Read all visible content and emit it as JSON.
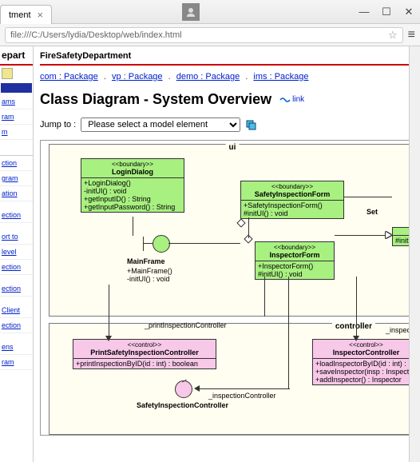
{
  "browser": {
    "tab_title": "tment",
    "address": "file:///C:/Users/lydia/Desktop/web/index.html"
  },
  "sidebar": {
    "header": "epart",
    "items": [
      "ams",
      "ram",
      "m",
      "ction",
      "gram",
      "ation",
      "ection",
      "ort to",
      "level",
      "ection",
      "ection",
      "Client",
      "ection",
      "ens",
      "ram"
    ]
  },
  "main": {
    "department": "FireSafetyDepartment",
    "breadcrumbs": [
      {
        "label": "com : Package"
      },
      {
        "label": "vp : Package"
      },
      {
        "label": "demo : Package"
      },
      {
        "label": "ims : Package"
      }
    ],
    "title": "Class Diagram - System Overview",
    "link_label": "link",
    "jump_label": "Jump to :",
    "jump_placeholder": "Please select a model element"
  },
  "diagram": {
    "pkg_ui": "ui",
    "pkg_controller": "controller",
    "set_label": "Set",
    "login_dialog": {
      "stereotype": "<<boundary>>",
      "name": "LoginDialog",
      "ops": [
        "+LoginDialog()",
        "-initUI() : void",
        "+getInputID() : String",
        "+getInputPassword() : String"
      ]
    },
    "safety_inspection_form": {
      "stereotype": "<<boundary>>",
      "name": "SafetyInspectionForm",
      "ops": [
        "+SafetyInspectionForm()",
        "#initUI() : void"
      ]
    },
    "inspector_form": {
      "stereotype": "<<boundary>>",
      "name": "InspectorForm",
      "ops": [
        "+InspectorForm()",
        "#initUI() : void"
      ]
    },
    "init_ui_box": {
      "ops": [
        "#initUI() :"
      ]
    },
    "main_frame": {
      "name": "MainFrame",
      "ops": [
        "+MainFrame()",
        "-initUI() : void"
      ]
    },
    "print_ctrl_label": "_printInspectionController",
    "inspection_ctrl_label": "_inspectionController",
    "inspec_label": "_inspec",
    "print_controller": {
      "stereotype": "<<control>>",
      "name": "PrintSafetyInspectionController",
      "ops": [
        "+printInspectionByID(id : int) : boolean"
      ]
    },
    "inspector_controller": {
      "stereotype": "<<control>>",
      "name": "InspectorController",
      "ops": [
        "+loadInspectorByID(id : int) : Inspector",
        "+saveInspector(insp : Inspector) : void",
        "+addInspector() : Inspector"
      ]
    },
    "safety_inspection_controller": {
      "name": "SafetyInspectionController"
    }
  }
}
